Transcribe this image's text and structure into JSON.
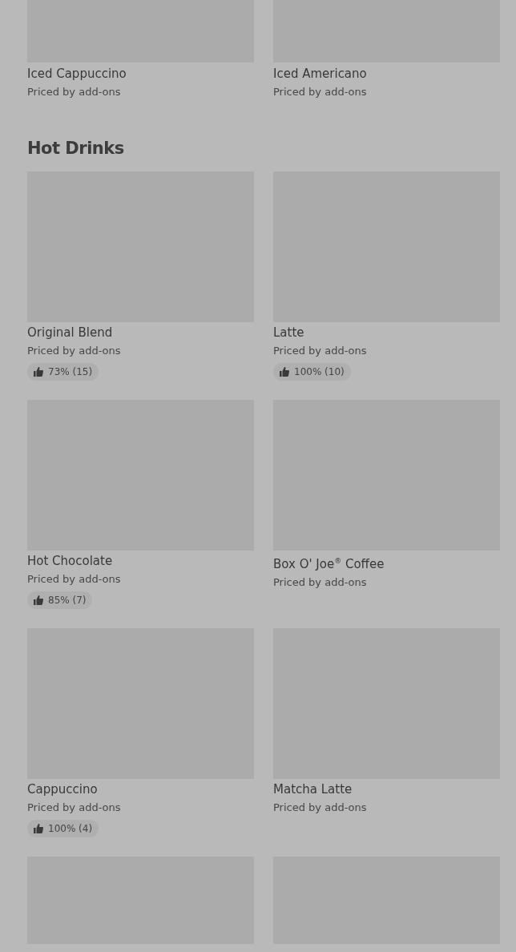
{
  "sections": [
    {
      "items": [
        {
          "kind": "card",
          "name": "Iced Cappuccino",
          "subtitle": "Priced by add-ons"
        },
        {
          "kind": "card",
          "name": "Iced Americano",
          "subtitle": "Priced by add-ons"
        }
      ]
    },
    {
      "heading": "Hot Drinks",
      "items": [
        {
          "kind": "card",
          "name": "Original Blend",
          "subtitle": "Priced by add-ons",
          "rating": "73% (15)"
        },
        {
          "kind": "card",
          "name": "Latte",
          "subtitle": "Priced by add-ons",
          "rating": "100% (10)"
        },
        {
          "kind": "card",
          "name": "Hot Chocolate",
          "subtitle": "Priced by add-ons",
          "rating": "85% (7)"
        },
        {
          "kind": "card",
          "name": "Box O' Joe$^{®}$ Coffee",
          "subtitle": "Priced by add-ons"
        },
        {
          "kind": "card",
          "name": "Cappuccino",
          "subtitle": "Priced by add-ons",
          "rating": "100% (4)"
        },
        {
          "kind": "card",
          "name": "Matcha Latte",
          "subtitle": "Priced by add-ons"
        },
        {
          "kind": "image_only"
        },
        {
          "kind": "image_only"
        }
      ]
    }
  ]
}
